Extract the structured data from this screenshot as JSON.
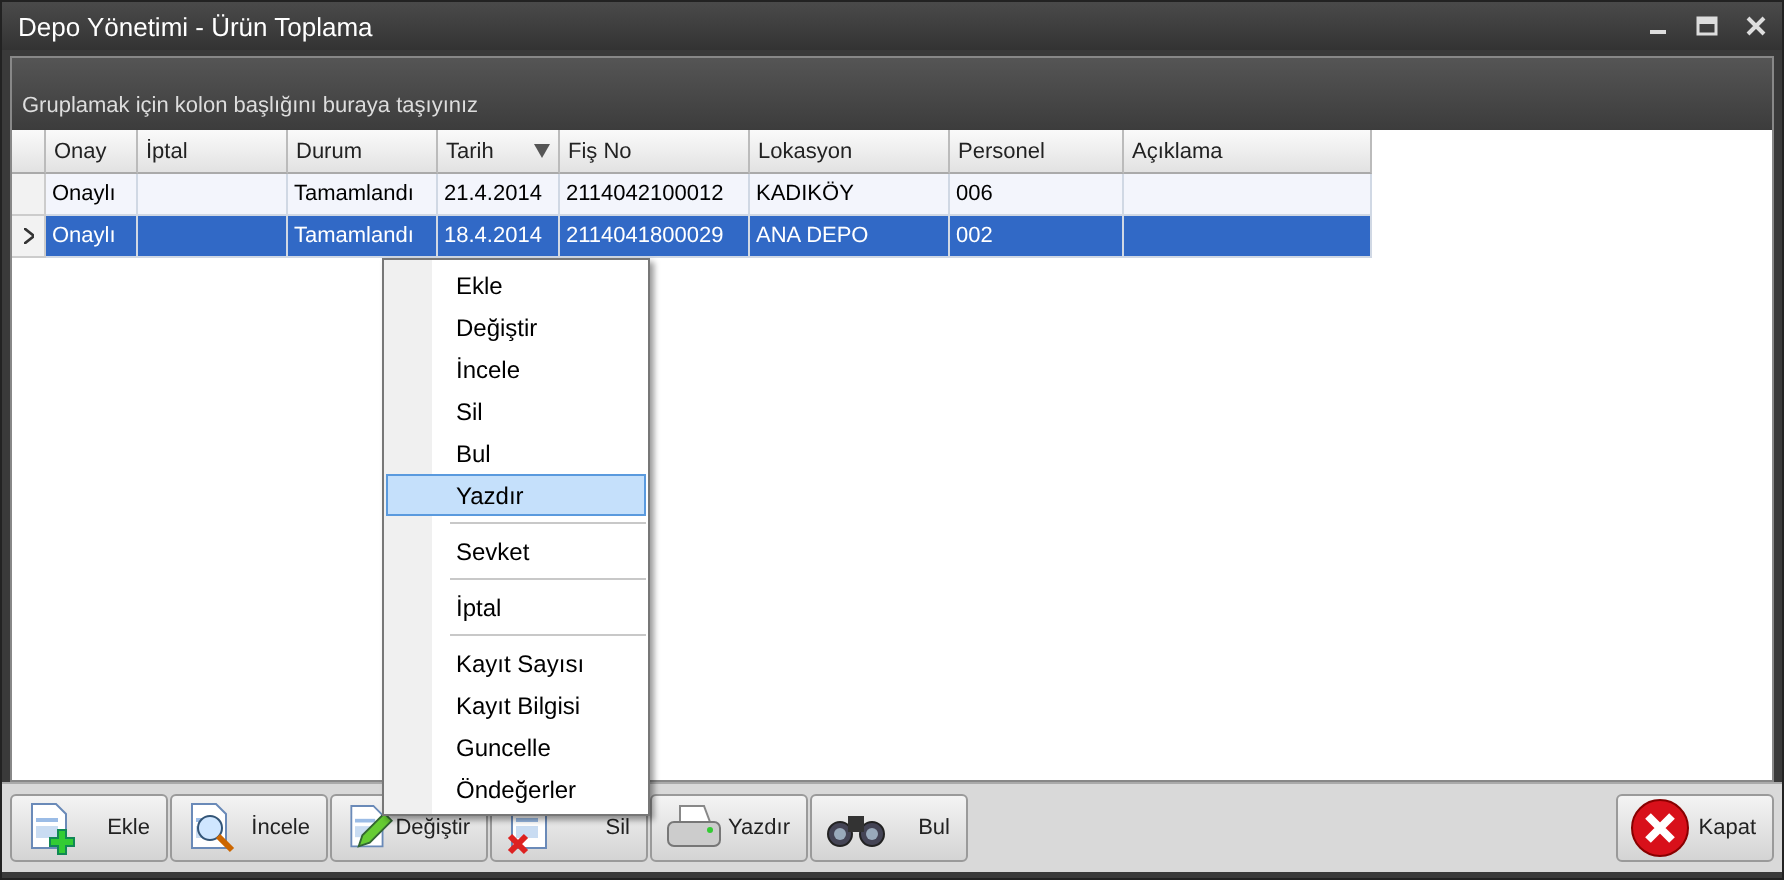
{
  "window": {
    "title": "Depo Yönetimi - Ürün Toplama"
  },
  "group_panel": {
    "hint": "Gruplamak için kolon başlığını buraya taşıyınız"
  },
  "table": {
    "columns": [
      {
        "label": "Onay",
        "sorted": false
      },
      {
        "label": "İptal",
        "sorted": false
      },
      {
        "label": "Durum",
        "sorted": false
      },
      {
        "label": "Tarih",
        "sorted": true
      },
      {
        "label": "Fiş No",
        "sorted": false
      },
      {
        "label": "Lokasyon",
        "sorted": false
      },
      {
        "label": "Personel",
        "sorted": false
      },
      {
        "label": "Açıklama",
        "sorted": false
      }
    ],
    "rows": [
      {
        "selected": false,
        "cells": [
          "Onaylı",
          "",
          "Tamamlandı",
          "21.4.2014",
          "2114042100012",
          "KADIKÖY",
          "006",
          ""
        ]
      },
      {
        "selected": true,
        "cells": [
          "Onaylı",
          "",
          "Tamamlandı",
          "18.4.2014",
          "2114041800029",
          "ANA DEPO",
          "002",
          ""
        ]
      }
    ]
  },
  "context_menu": [
    {
      "kind": "item",
      "label": "Ekle",
      "selected": false
    },
    {
      "kind": "item",
      "label": "Değiştir",
      "selected": false
    },
    {
      "kind": "item",
      "label": "İncele",
      "selected": false
    },
    {
      "kind": "item",
      "label": "Sil",
      "selected": false
    },
    {
      "kind": "item",
      "label": "Bul",
      "selected": false
    },
    {
      "kind": "item",
      "label": "Yazdır",
      "selected": true
    },
    {
      "kind": "separator"
    },
    {
      "kind": "item",
      "label": "Sevket",
      "selected": false
    },
    {
      "kind": "separator"
    },
    {
      "kind": "item",
      "label": "İptal",
      "selected": false
    },
    {
      "kind": "separator"
    },
    {
      "kind": "item",
      "label": "Kayıt Sayısı",
      "selected": false
    },
    {
      "kind": "item",
      "label": "Kayıt Bilgisi",
      "selected": false
    },
    {
      "kind": "item",
      "label": "Guncelle",
      "selected": false
    },
    {
      "kind": "item",
      "label": "Öndeğerler",
      "selected": false
    }
  ],
  "toolbar": [
    {
      "kind": "add",
      "label": "Ekle"
    },
    {
      "kind": "view",
      "label": "İncele"
    },
    {
      "kind": "edit",
      "label": "Değiştir"
    },
    {
      "kind": "delete",
      "label": "Sil"
    },
    {
      "kind": "print",
      "label": "Yazdır"
    },
    {
      "kind": "find",
      "label": "Bul"
    }
  ],
  "close_button": {
    "kind": "close",
    "label": "Kapat"
  }
}
